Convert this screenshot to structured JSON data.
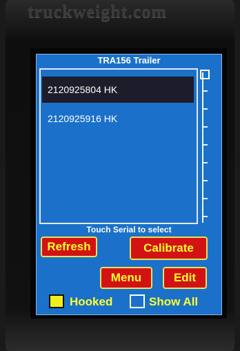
{
  "device": {
    "brand_text": "truckweight.com"
  },
  "screen": {
    "title": "TRA156 Trailer",
    "list": {
      "items": [
        {
          "label": "2120925804 HK",
          "selected": true
        },
        {
          "label": "2120925916 HK",
          "selected": false
        }
      ]
    },
    "hint": "Touch  Serial to select",
    "buttons": {
      "refresh": "Refresh",
      "calibrate": "Calibrate",
      "menu": "Menu",
      "edit": "Edit"
    },
    "checkboxes": {
      "hooked": {
        "label": "Hooked",
        "checked": true
      },
      "show_all": {
        "label": "Show All",
        "checked": false
      }
    }
  },
  "colors": {
    "screen_bg": "#1b71c9",
    "button_bg": "#d31313",
    "button_text": "#ffff2e",
    "selected_row": "#1c1c2a"
  }
}
